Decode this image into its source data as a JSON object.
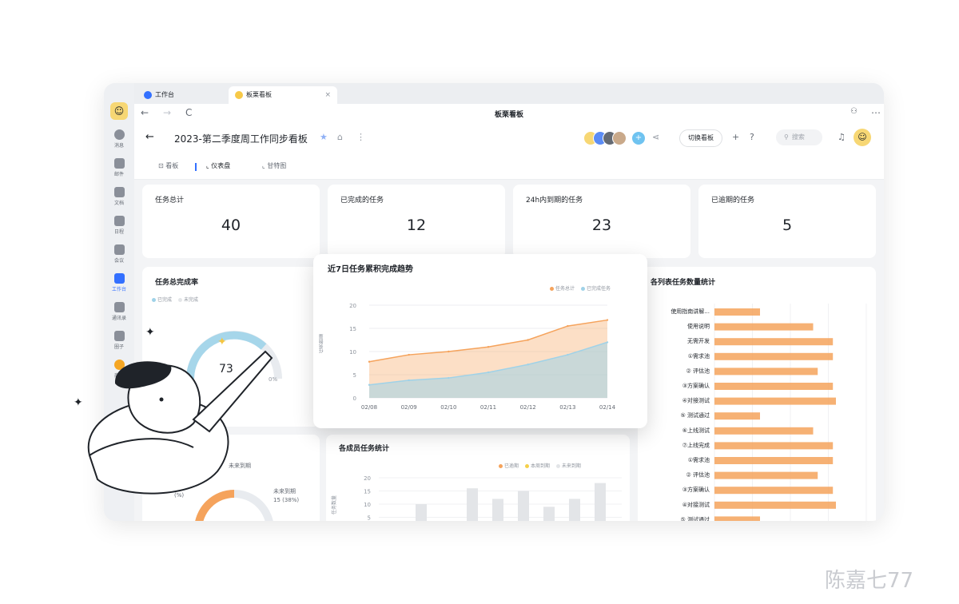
{
  "tabs": [
    {
      "label": "工作台"
    },
    {
      "label": "板栗看板",
      "close": "×"
    }
  ],
  "nav": {
    "title": "板栗看板",
    "back": "←",
    "forward": "→",
    "reload": "C"
  },
  "rail": {
    "items": [
      {
        "label": "消息"
      },
      {
        "label": "邮件"
      },
      {
        "label": "文档"
      },
      {
        "label": "日程"
      },
      {
        "label": "会议"
      },
      {
        "label": "工作台"
      },
      {
        "label": "通讯录"
      },
      {
        "label": "圈子"
      },
      {
        "label": "商城"
      }
    ]
  },
  "header": {
    "title": "2023-第二季度周工作同步看板",
    "switch_label": "切换看板",
    "search_placeholder": "搜索"
  },
  "view_tabs": [
    {
      "label": "看板"
    },
    {
      "label": "仪表盘"
    },
    {
      "label": "甘特图"
    }
  ],
  "stats": [
    {
      "label": "任务总计",
      "value": "40"
    },
    {
      "label": "已完成的任务",
      "value": "12"
    },
    {
      "label": "24h内到期的任务",
      "value": "23"
    },
    {
      "label": "已逾期的任务",
      "value": "5"
    }
  ],
  "completion": {
    "title": "任务总完成率",
    "legend_done": "已完成",
    "legend_undone": "未完成",
    "value": "73",
    "pct": "0%"
  },
  "member_chart_left": {
    "label1": "未来到期",
    "label2": "未来到期",
    "label2b": "15 (38%)",
    "label3": "(%)",
    "center": "未来到期"
  },
  "chart_data": [
    {
      "type": "area",
      "title": "近7日任务累积完成趋势",
      "ylabel": "任务数量",
      "x": [
        "02/08",
        "02/09",
        "02/10",
        "02/11",
        "02/12",
        "02/13",
        "02/14"
      ],
      "ylim": [
        0,
        20
      ],
      "yticks": [
        "0",
        "5",
        "10",
        "15",
        "20"
      ],
      "series": [
        {
          "name": "任务总计",
          "color": "#f5a35c",
          "values": [
            7.8,
            9.3,
            10.0,
            11.0,
            12.5,
            15.5,
            16.8
          ]
        },
        {
          "name": "已完成任务",
          "color": "#9fd2e8",
          "values": [
            2.8,
            3.8,
            4.3,
            5.5,
            7.2,
            9.3,
            12.0
          ]
        }
      ]
    },
    {
      "type": "bar",
      "title": "各成员任务统计",
      "ylabel": "任务数量",
      "ylim": [
        0,
        20
      ],
      "yticks": [
        "5",
        "10",
        "15",
        "20"
      ],
      "series": [
        {
          "name": "已逾期",
          "color": "#f5a35c"
        },
        {
          "name": "本周到期",
          "color": "#f5d04a",
          "values": [
            0,
            0,
            0,
            2,
            1,
            0,
            0,
            0,
            1
          ]
        },
        {
          "name": "未来到期",
          "color": "#e3e5e8",
          "values": [
            0,
            10,
            0,
            14,
            11,
            15,
            9,
            12,
            17
          ]
        }
      ]
    },
    {
      "type": "bar",
      "title": "各列表任务数量统计",
      "categories": [
        "使用指南讲解...",
        "使用说明",
        "无需开发",
        "①需求池",
        "② 评估池",
        "③方案确认",
        "④对接测试",
        "⑤ 测试通过",
        "⑥上线测试",
        "⑦上线完成",
        "①需求池",
        "② 评估池",
        "③方案确认",
        "④对接测试",
        "⑤ 测试通过"
      ],
      "values": [
        3,
        6.5,
        7.8,
        7.8,
        6.8,
        7.8,
        8,
        3,
        6.5,
        7.8,
        7.8,
        6.8,
        7.8,
        8,
        3
      ],
      "color": "#f5a35c"
    }
  ],
  "watermark": "陈嘉七77"
}
